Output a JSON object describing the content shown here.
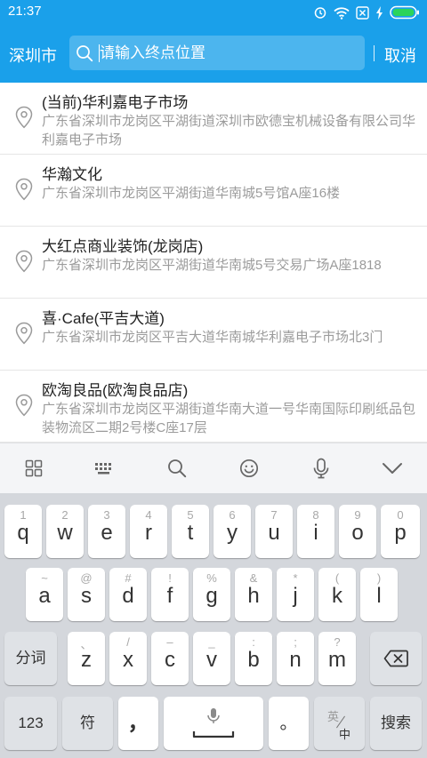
{
  "status_bar": {
    "time": "21:37",
    "icons": [
      "alarm-icon",
      "wifi-icon",
      "no-sim-icon",
      "charging-icon",
      "battery-icon"
    ]
  },
  "header": {
    "city": "深圳市",
    "search_placeholder": "请输入终点位置",
    "cancel_label": "取消"
  },
  "results": [
    {
      "name": "(当前)华利嘉电子市场",
      "address": "广东省深圳市龙岗区平湖街道深圳市欧德宝机械设备有限公司华利嘉电子市场"
    },
    {
      "name": "华瀚文化",
      "address": "广东省深圳市龙岗区平湖街道华南城5号馆A座16楼"
    },
    {
      "name": "大红点商业装饰(龙岗店)",
      "address": "广东省深圳市龙岗区平湖街道华南城5号交易广场A座1818"
    },
    {
      "name": "喜·Cafe(平吉大道)",
      "address": "广东省深圳市龙岗区平吉大道华南城华利嘉电子市场北3门"
    },
    {
      "name": "欧淘良品(欧淘良品店)",
      "address": "广东省深圳市龙岗区平湖街道华南大道一号华南国际印刷纸品包装物流区二期2号楼C座17层"
    }
  ],
  "keyboard": {
    "toolbar": [
      "grid-icon",
      "keyboard-icon",
      "search-icon",
      "emoji-icon",
      "mic-icon",
      "collapse-icon"
    ],
    "row1": [
      {
        "main": "q",
        "sub": "1"
      },
      {
        "main": "w",
        "sub": "2"
      },
      {
        "main": "e",
        "sub": "3"
      },
      {
        "main": "r",
        "sub": "4"
      },
      {
        "main": "t",
        "sub": "5"
      },
      {
        "main": "y",
        "sub": "6"
      },
      {
        "main": "u",
        "sub": "7"
      },
      {
        "main": "i",
        "sub": "8"
      },
      {
        "main": "o",
        "sub": "9"
      },
      {
        "main": "p",
        "sub": "0"
      }
    ],
    "row2": [
      {
        "main": "a",
        "sub": "~"
      },
      {
        "main": "s",
        "sub": "@"
      },
      {
        "main": "d",
        "sub": "#"
      },
      {
        "main": "f",
        "sub": "!"
      },
      {
        "main": "g",
        "sub": "%"
      },
      {
        "main": "h",
        "sub": "&"
      },
      {
        "main": "j",
        "sub": "*"
      },
      {
        "main": "k",
        "sub": "("
      },
      {
        "main": "l",
        "sub": ")"
      }
    ],
    "row3": [
      {
        "main": "z",
        "sub": "、"
      },
      {
        "main": "x",
        "sub": "/"
      },
      {
        "main": "c",
        "sub": "–"
      },
      {
        "main": "v",
        "sub": "_"
      },
      {
        "main": "b",
        "sub": ":"
      },
      {
        "main": "n",
        "sub": ";"
      },
      {
        "main": "m",
        "sub": "?"
      }
    ],
    "fenci_label": "分词",
    "num_label": "123",
    "symbol_label": "符",
    "comma_label": "，",
    "period_label": "。",
    "lang_top": "英",
    "lang_bottom": "中",
    "search_label": "搜索"
  },
  "colors": {
    "accent": "#1aa0ea",
    "text_primary": "#222222",
    "text_secondary": "#9b9b9b",
    "keyboard_bg": "#d4d7dc"
  }
}
